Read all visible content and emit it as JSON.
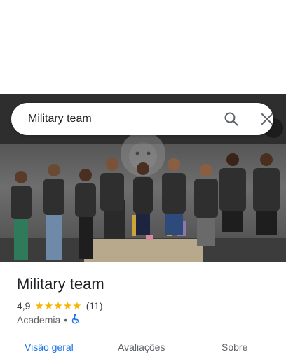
{
  "search": {
    "query": "Military team"
  },
  "place": {
    "title": "Military team",
    "rating": "4,9",
    "rating_value": 4.9,
    "stars_filled": 5,
    "review_count": "(11)",
    "category": "Academia",
    "separator": "•",
    "accessibility_icon": "wheelchair-icon"
  },
  "tabs": [
    {
      "label": "Visão geral",
      "active": true
    },
    {
      "label": "Avaliações",
      "active": false
    },
    {
      "label": "Sobre",
      "active": false
    }
  ],
  "colors": {
    "accent": "#1a73e8",
    "star": "#f6b400",
    "text": "#202124",
    "muted": "#5f6368"
  }
}
